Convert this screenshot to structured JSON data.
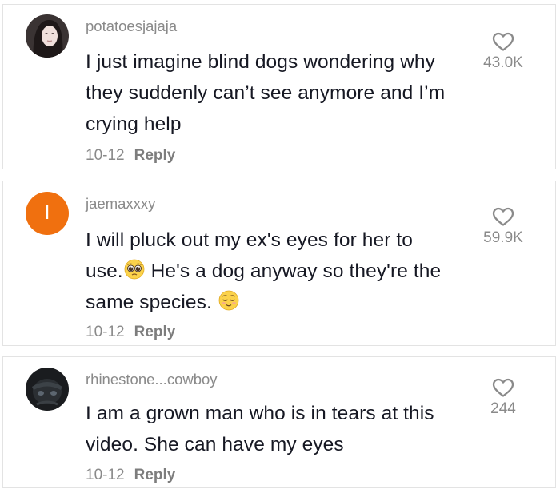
{
  "comments": [
    {
      "username": "potatoesjajaja",
      "text_lines": [
        "I just imagine blind dogs wondering why",
        "they suddenly can’t see anymore and I’m",
        "crying help"
      ],
      "date": "10-12",
      "reply_label": "Reply",
      "likes": "43.0K",
      "avatar": "photo-dark-hair"
    },
    {
      "username": "jaemaxxxy",
      "avatar_letter": "I",
      "avatar_color": "#f0700f",
      "text_line1_a": "I will pluck out my ex's eyes for her to",
      "text_line2_a": "use.",
      "text_line2_b": " He's a dog anyway so they're the",
      "text_line3_a": "same species. ",
      "emoji_1": "pleading-face",
      "emoji_2": "relieved-face",
      "date": "10-12",
      "reply_label": "Reply",
      "likes": "59.9K"
    },
    {
      "username": "rhinestone...cowboy",
      "text_lines": [
        "I am a grown man who is in tears at this",
        "video. She can have my eyes"
      ],
      "date": "10-12",
      "reply_label": "Reply",
      "likes": "244",
      "avatar": "photo-dark-figure"
    }
  ],
  "icons": {
    "like": "heart-outline-icon"
  },
  "colors": {
    "text": "#161823",
    "muted": "#8a8a8a",
    "border": "#e3e3e3",
    "avatar_orange": "#f0700f"
  }
}
